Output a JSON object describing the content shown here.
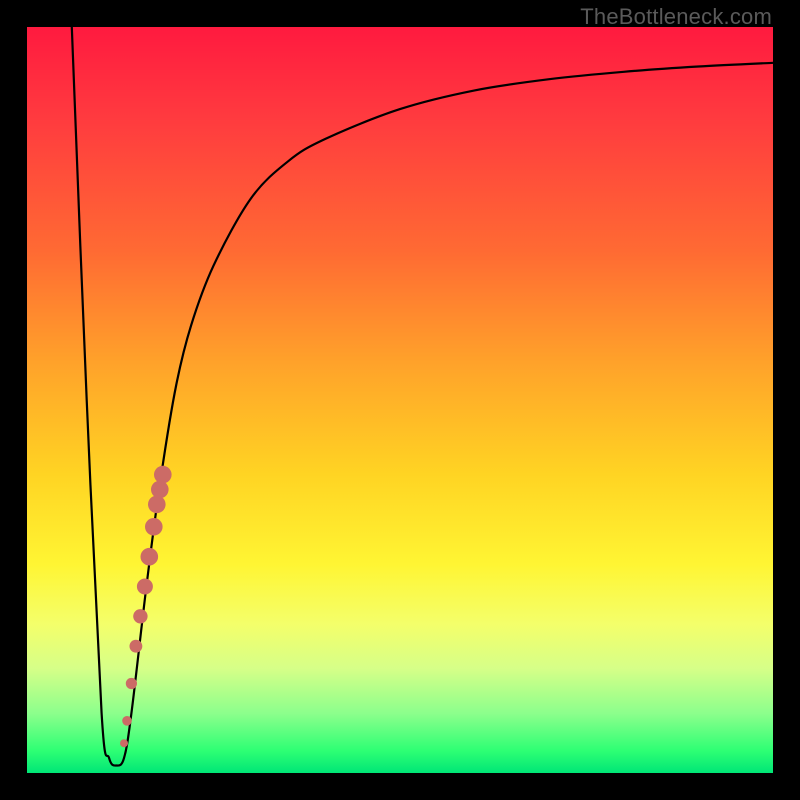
{
  "watermark": "TheBottleneck.com",
  "colors": {
    "frame": "#000000",
    "curve": "#000000",
    "dot": "#cc6b66",
    "gradient_stops": [
      "#ff1a3f",
      "#ff6a33",
      "#ffd423",
      "#fff533",
      "#8cff8c",
      "#00e676"
    ]
  },
  "chart_data": {
    "type": "line",
    "title": "",
    "xlabel": "",
    "ylabel": "",
    "xlim": [
      0,
      100
    ],
    "ylim": [
      0,
      100
    ],
    "grid": false,
    "legend": false,
    "series": [
      {
        "name": "bottleneck-curve",
        "x": [
          6,
          8,
          10,
          11,
          12,
          13,
          14,
          16,
          18,
          20,
          22,
          25,
          30,
          35,
          40,
          50,
          60,
          70,
          80,
          90,
          100
        ],
        "y": [
          100,
          50,
          8,
          2,
          1,
          2,
          8,
          25,
          40,
          52,
          60,
          68,
          77,
          82,
          85,
          89,
          91.5,
          93,
          94,
          94.7,
          95.2
        ]
      }
    ],
    "annotations": {
      "dots_region_note": "salmon dots along rising right wall of V",
      "dots": [
        {
          "x": 13.0,
          "y": 4
        },
        {
          "x": 13.4,
          "y": 7
        },
        {
          "x": 14.0,
          "y": 12
        },
        {
          "x": 14.6,
          "y": 17
        },
        {
          "x": 15.2,
          "y": 21
        },
        {
          "x": 15.8,
          "y": 25
        },
        {
          "x": 16.4,
          "y": 29
        },
        {
          "x": 17.0,
          "y": 33
        },
        {
          "x": 17.4,
          "y": 36
        },
        {
          "x": 17.8,
          "y": 38
        },
        {
          "x": 18.2,
          "y": 40
        }
      ]
    }
  }
}
